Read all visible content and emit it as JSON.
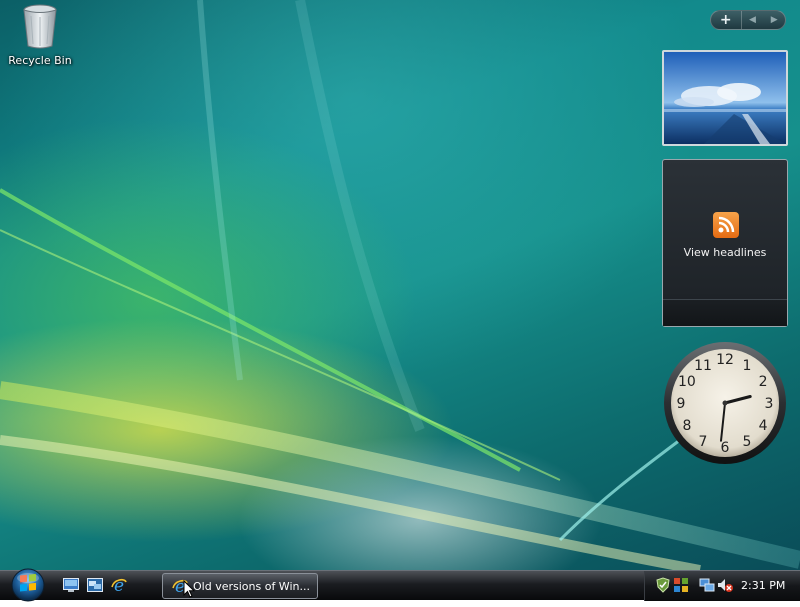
{
  "desktop": {
    "icons": [
      {
        "label": "Recycle Bin",
        "icon": "recycle-bin-icon"
      }
    ]
  },
  "sidebar": {
    "controls": {
      "add_label": "+",
      "prev_label": "◀",
      "next_label": "▶"
    },
    "gadgets": {
      "slideshow": {
        "name": "slideshow-gadget"
      },
      "feeds": {
        "link_text": "View headlines",
        "icon": "rss-icon"
      },
      "clock": {
        "numerals": [
          "12",
          "1",
          "2",
          "3",
          "4",
          "5",
          "6",
          "7",
          "8",
          "9",
          "10",
          "11"
        ],
        "hours": 2,
        "minutes": 31
      }
    }
  },
  "taskbar": {
    "start_icon": "windows-start-orb",
    "quick_launch": [
      {
        "icon": "show-desktop-icon"
      },
      {
        "icon": "switch-windows-icon"
      },
      {
        "icon": "internet-explorer-icon"
      }
    ],
    "tasks": [
      {
        "label": "Old versions of Win...",
        "icon": "internet-explorer-icon"
      }
    ],
    "tray": {
      "icons": [
        "windows-defender-icon",
        "security-center-icon",
        "network-icon",
        "volume-muted-icon"
      ],
      "time": "2:31 PM"
    }
  },
  "colors": {
    "taskbar": "#1b1d21",
    "desktop_base": "#128a8c",
    "rss_orange": "#f08a24"
  }
}
